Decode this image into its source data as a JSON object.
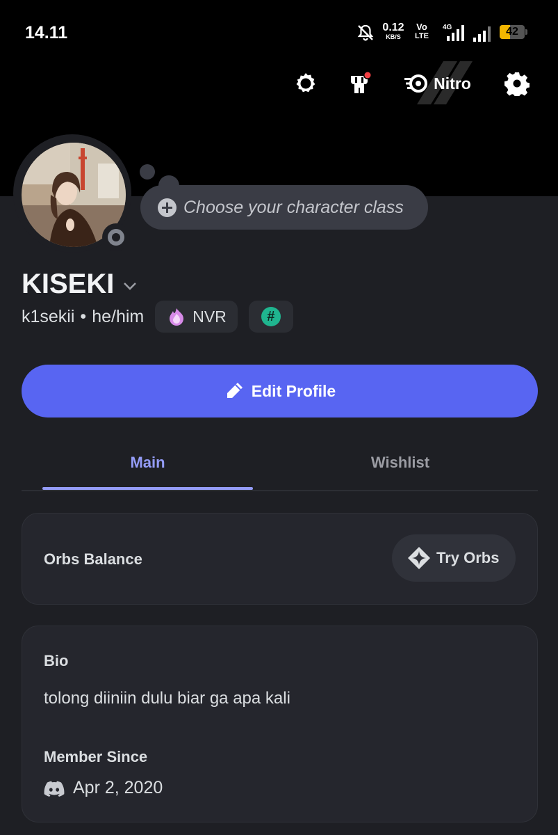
{
  "status_bar": {
    "time": "14.11",
    "net_speed_value": "0.12",
    "net_speed_unit": "KB/S",
    "volte_top": "Vo",
    "volte_bottom": "LTE",
    "battery": "42",
    "battery_level": 0.42,
    "icons": [
      "bell-muted-icon",
      "signal-4g-icon",
      "signal-icon",
      "battery-icon"
    ]
  },
  "header": {
    "nitro_label": "Nitro",
    "icons": [
      "quest-badge-icon",
      "shop-icon",
      "nitro-icon",
      "settings-gear-icon"
    ]
  },
  "profile": {
    "custom_status_placeholder": "Choose your character class",
    "display_name": "KISEKI",
    "username": "k1sekii",
    "separator": "•",
    "pronouns": "he/him",
    "clan_tag": "NVR",
    "status": "offline"
  },
  "actions": {
    "edit_profile": "Edit Profile"
  },
  "tabs": [
    {
      "label": "Main",
      "active": true
    },
    {
      "label": "Wishlist",
      "active": false
    }
  ],
  "orbs": {
    "label": "Orbs Balance",
    "button": "Try Orbs"
  },
  "about": {
    "bio_heading": "Bio",
    "bio_text": "tolong diiniin dulu biar ga apa kali",
    "member_since_heading": "Member Since",
    "member_since_date": "Apr 2, 2020"
  },
  "colors": {
    "background": "#1e1f24",
    "banner": "#000000",
    "accent": "#5865f2",
    "tab_active": "#949cf7",
    "card": "#25262d"
  }
}
